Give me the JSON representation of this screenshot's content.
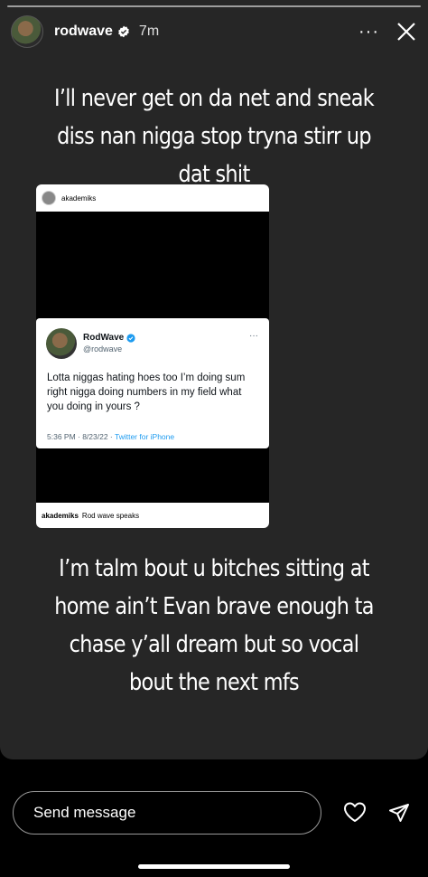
{
  "header": {
    "username": "rodwave",
    "time_ago": "7m",
    "more_label": "···"
  },
  "caption_top": "I’ll never get on da net and sneak diss nan nigga stop tryna stirr up dat shit",
  "embedded_post": {
    "account": "akademiks",
    "caption_user": "akademiks",
    "caption_text": "Rod wave speaks",
    "tweet": {
      "display_name": "RodWave",
      "handle": "@rodwave",
      "more_label": "···",
      "text": "Lotta niggas hating hoes too I’m doing sum right nigga doing numbers in my field what you doing in yours ?",
      "timestamp": "5:36 PM · 8/23/22 · ",
      "source": "Twitter for iPhone"
    }
  },
  "caption_bottom": "I’m talm bout u bitches sitting at home ain’t Evan brave enough ta chase y’all dream but so vocal bout the next mfs",
  "reply": {
    "placeholder": "Send message"
  },
  "icons": {
    "verified": "verified-badge-icon",
    "close": "close-icon",
    "heart": "heart-icon",
    "share": "paper-plane-icon"
  },
  "colors": {
    "story_bg": "#262626",
    "verified": "#1d9bf0",
    "twitter_link": "#1d9bf0"
  }
}
